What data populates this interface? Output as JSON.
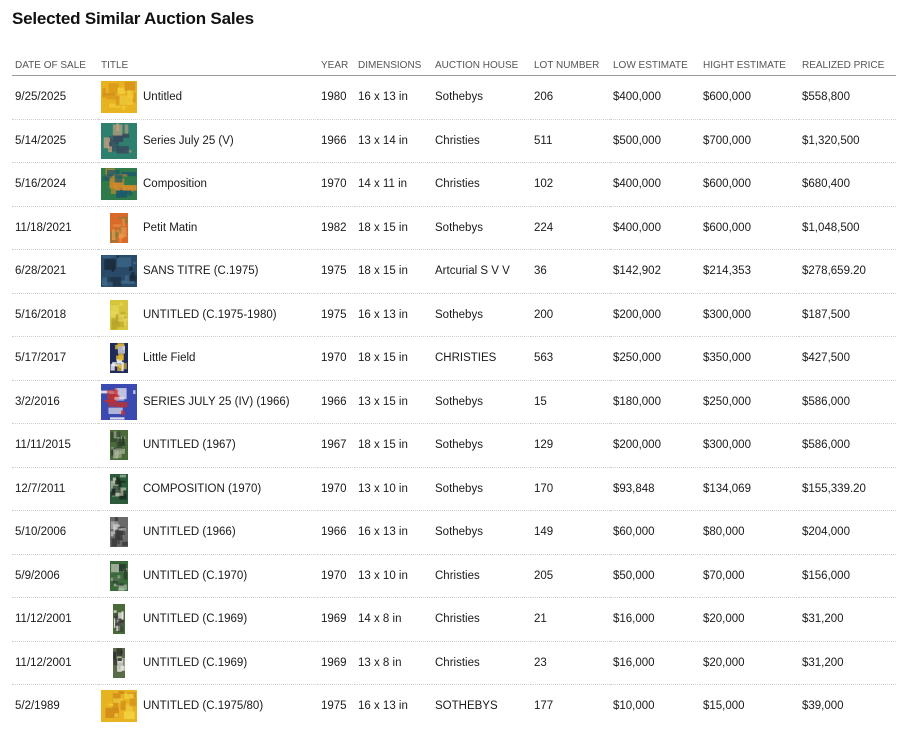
{
  "title": "Selected Similar Auction Sales",
  "columns": {
    "date": "DATE OF SALE",
    "title": "TITLE",
    "year": "YEAR",
    "dimensions": "DIMENSIONS",
    "house": "AUCTION HOUSE",
    "lot": "LOT NUMBER",
    "low": "LOW ESTIMATE",
    "high": "HIGHT ESTIMATE",
    "price": "REALIZED PRICE"
  },
  "rows": [
    {
      "date": "9/25/2025",
      "title": "Untitled",
      "year": "1980",
      "dimensions": "16 x 13 in",
      "house": "Sothebys",
      "lot": "206",
      "low": "$400,000",
      "high": "$600,000",
      "price": "$558,800",
      "thumb": {
        "icon": "yellow-abstract-painting-thumbnail",
        "colors": [
          "#e8b320",
          "#d4901a",
          "#f2cf3a"
        ],
        "aspect": "landscape"
      }
    },
    {
      "date": "5/14/2025",
      "title": "Series July 25 (V)",
      "year": "1966",
      "dimensions": "13 x 14 in",
      "house": "Christies",
      "lot": "511",
      "low": "$500,000",
      "high": "$700,000",
      "price": "$1,320,500",
      "thumb": {
        "icon": "teal-abstract-painting-thumbnail",
        "colors": [
          "#2f7f6e",
          "#c0a080",
          "#384a5e"
        ],
        "aspect": "square"
      }
    },
    {
      "date": "5/16/2024",
      "title": "Composition",
      "year": "1970",
      "dimensions": "14 x 11 in",
      "house": "Christies",
      "lot": "102",
      "low": "$400,000",
      "high": "$600,000",
      "price": "$680,400",
      "thumb": {
        "icon": "green-orange-abstract-thumbnail",
        "colors": [
          "#2f7a4a",
          "#d98a2a",
          "#1e5a6a"
        ],
        "aspect": "landscape"
      }
    },
    {
      "date": "11/18/2021",
      "title": "Petit Matin",
      "year": "1982",
      "dimensions": "18 x 15 in",
      "house": "Sothebys",
      "lot": "224",
      "low": "$400,000",
      "high": "$600,000",
      "price": "$1,048,500",
      "thumb": {
        "icon": "orange-abstract-thumbnail",
        "colors": [
          "#d96a2a",
          "#e89a4a",
          "#8a7a3a"
        ],
        "aspect": "portrait"
      }
    },
    {
      "date": "6/28/2021",
      "title": "SANS TITRE (C.1975)",
      "year": "1975",
      "dimensions": "18 x 15 in",
      "house": "Artcurial S V V",
      "lot": "36",
      "low": "$142,902",
      "high": "$214,353",
      "price": "$278,659.20",
      "thumb": {
        "icon": "blue-abstract-thumbnail",
        "colors": [
          "#2a4a6a",
          "#3e6a8a",
          "#1a2a3a"
        ],
        "aspect": "landscape"
      }
    },
    {
      "date": "5/16/2018",
      "title": "UNTITLED (C.1975-1980)",
      "year": "1975",
      "dimensions": "16 x 13 in",
      "house": "Sothebys",
      "lot": "200",
      "low": "$200,000",
      "high": "$300,000",
      "price": "$187,500",
      "thumb": {
        "icon": "yellow-abstract-thumbnail",
        "colors": [
          "#d6c43a",
          "#b8a42a",
          "#e8d860"
        ],
        "aspect": "portrait"
      }
    },
    {
      "date": "5/17/2017",
      "title": "Little Field",
      "year": "1970",
      "dimensions": "18 x 15 in",
      "house": "CHRISTIES",
      "lot": "563",
      "low": "$250,000",
      "high": "$350,000",
      "price": "$427,500",
      "thumb": {
        "icon": "navy-yellow-abstract-thumbnail",
        "colors": [
          "#1e2a5a",
          "#e0b830",
          "#f0f0f0"
        ],
        "aspect": "portrait"
      }
    },
    {
      "date": "3/2/2016",
      "title": "SERIES JULY 25 (IV) (1966)",
      "year": "1966",
      "dimensions": "13 x 15 in",
      "house": "Sothebys",
      "lot": "15",
      "low": "$180,000",
      "high": "$250,000",
      "price": "$586,000",
      "thumb": {
        "icon": "blue-white-abstract-thumbnail",
        "colors": [
          "#3a4ab0",
          "#e8e8f0",
          "#c03030"
        ],
        "aspect": "square"
      }
    },
    {
      "date": "11/11/2015",
      "title": "UNTITLED (1967)",
      "year": "1967",
      "dimensions": "18 x 15 in",
      "house": "Sothebys",
      "lot": "129",
      "low": "$200,000",
      "high": "$300,000",
      "price": "$586,000",
      "thumb": {
        "icon": "green-abstract-thumbnail",
        "colors": [
          "#4a6a3a",
          "#b0b8a0",
          "#2a3a2a"
        ],
        "aspect": "portrait"
      }
    },
    {
      "date": "12/7/2011",
      "title": "COMPOSITION (1970)",
      "year": "1970",
      "dimensions": "13 x 10 in",
      "house": "Sothebys",
      "lot": "170",
      "low": "$93,848",
      "high": "$134,069",
      "price": "$155,339.20",
      "thumb": {
        "icon": "dark-green-abstract-thumbnail",
        "colors": [
          "#2a5a3a",
          "#c0c8b0",
          "#1a2a20"
        ],
        "aspect": "portrait"
      }
    },
    {
      "date": "5/10/2006",
      "title": "UNTITLED (1966)",
      "year": "1966",
      "dimensions": "16 x 13 in",
      "house": "Sothebys",
      "lot": "149",
      "low": "$60,000",
      "high": "$80,000",
      "price": "$204,000",
      "thumb": {
        "icon": "grey-abstract-thumbnail",
        "colors": [
          "#6a6a6a",
          "#d0d0d0",
          "#3a3a3a"
        ],
        "aspect": "portrait"
      }
    },
    {
      "date": "5/9/2006",
      "title": "UNTITLED (C.1970)",
      "year": "1970",
      "dimensions": "13 x 10 in",
      "house": "Christies",
      "lot": "205",
      "low": "$50,000",
      "high": "$70,000",
      "price": "$156,000",
      "thumb": {
        "icon": "green-grey-abstract-thumbnail",
        "colors": [
          "#3a6a3a",
          "#a8b8a0",
          "#2a3a30"
        ],
        "aspect": "portrait"
      }
    },
    {
      "date": "11/12/2001",
      "title": "UNTITLED (C.1969)",
      "year": "1969",
      "dimensions": "14 x 8 in",
      "house": "Christies",
      "lot": "21",
      "low": "$16,000",
      "high": "$20,000",
      "price": "$31,200",
      "thumb": {
        "icon": "narrow-green-abstract-thumbnail",
        "colors": [
          "#4a6a3a",
          "#e8e8e0",
          "#3a3a3a"
        ],
        "aspect": "narrow"
      }
    },
    {
      "date": "11/12/2001",
      "title": "UNTITLED (C.1969)",
      "year": "1969",
      "dimensions": "13 x 8 in",
      "house": "Christies",
      "lot": "23",
      "low": "$16,000",
      "high": "$20,000",
      "price": "$31,200",
      "thumb": {
        "icon": "narrow-grey-abstract-thumbnail",
        "colors": [
          "#5a6a4a",
          "#e0e0d8",
          "#2a2a2a"
        ],
        "aspect": "narrow"
      }
    },
    {
      "date": "5/2/1989",
      "title": "UNTITLED (C.1975/80)",
      "year": "1975",
      "dimensions": "16 x 13 in",
      "house": "SOTHEBYS",
      "lot": "177",
      "low": "$10,000",
      "high": "$15,000",
      "price": "$39,000",
      "thumb": {
        "icon": "yellow-abstract-thumbnail",
        "colors": [
          "#e8b320",
          "#d08a1a",
          "#f2d040"
        ],
        "aspect": "landscape"
      }
    }
  ]
}
